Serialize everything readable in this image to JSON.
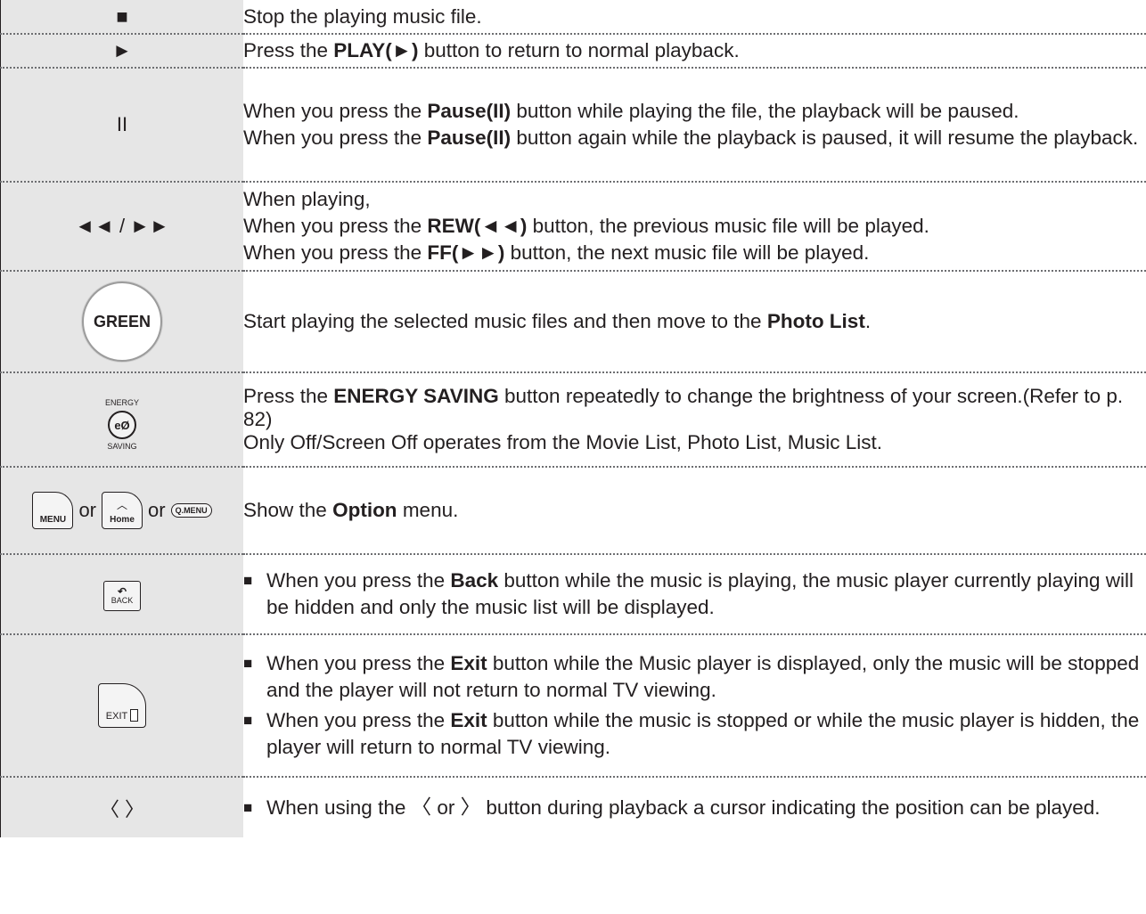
{
  "rows": {
    "stop": {
      "key": "■",
      "text": "Stop the playing music file."
    },
    "play": {
      "key": "►",
      "t1": "Press the ",
      "b1": "PLAY(►)",
      "t2": " button to return to normal playback."
    },
    "pause": {
      "key": "II",
      "l1_t1": "When you press the ",
      "l1_b1": "Pause(II)",
      "l1_t2": " button while playing the file, the playback will be paused.",
      "l2_t1": "When you press the ",
      "l2_b1": "Pause(II)",
      "l2_t2": " button again while the playback is paused, it will resume the playback."
    },
    "rewff": {
      "key": "◄◄ / ►►",
      "l0": "When playing,",
      "l1_t1": "When you press the ",
      "l1_b1": "REW(◄◄)",
      "l1_t2": " button, the previous music file will be played.",
      "l2_t1": "When you press the ",
      "l2_b1": "FF(►►)",
      "l2_t2": " button, the next music file will be played."
    },
    "green": {
      "key": "GREEN",
      "t1": "Start playing the selected music files and then move to the ",
      "b1": "Photo List",
      "t2": "."
    },
    "energy": {
      "key_top": "ENERGY",
      "key_symbol": "eØ",
      "key_bottom": "SAVING",
      "l1_t1": "Press the ",
      "l1_b1": "ENERGY SAVING",
      "l1_t2": " button repeatedly to change the brightness of your screen.(Refer to p. 82)",
      "l2": "Only Off/Screen Off operates from the Movie List, Photo List, Music List."
    },
    "option": {
      "key_menu": "MENU",
      "key_or1": "or",
      "key_home": "Home",
      "key_or2": "or",
      "key_qmenu": "Q.MENU",
      "t1": "Show the ",
      "b1": "Option",
      "t2": " menu."
    },
    "back": {
      "key": "BACK",
      "bullet": "■",
      "t1": "When you press the ",
      "b1": "Back",
      "t2": " button while the music is playing, the music player currently playing will be hidden and only the music list will be displayed."
    },
    "exit": {
      "key": "EXIT",
      "bullet": "■",
      "i1_t1": "When you press the ",
      "i1_b1": "Exit",
      "i1_t2": " button while the Music player is displayed, only the music will be stopped and the player will not return to normal TV viewing.",
      "i2_t1": "When you press the ",
      "i2_b1": "Exit",
      "i2_t2": " button while the music is stopped or while the music player is hidden, the player will return to normal TV viewing."
    },
    "cursor": {
      "key": "〈 〉",
      "bullet": "■",
      "text": "When using the 〈 or 〉 button during playback a cursor indicating the position can be played."
    }
  },
  "icons": {
    "energy": "energy-saving-icon",
    "home": "home-icon",
    "back": "back-arrow-icon",
    "exit": "exit-door-icon"
  }
}
